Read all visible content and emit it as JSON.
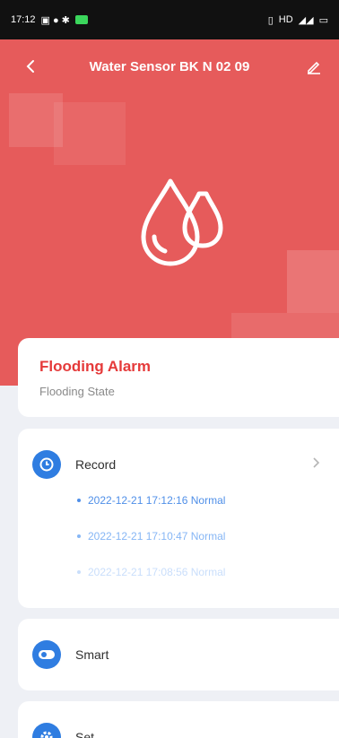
{
  "status_bar": {
    "time": "17:12",
    "right_text": "HD"
  },
  "header": {
    "title": "Water Sensor BK N 02 09",
    "back_icon": "back-chevron-icon",
    "edit_icon": "edit-pencil-icon"
  },
  "hero": {
    "icon": "water-drops-icon",
    "bg_color": "#e65b5b"
  },
  "alarm": {
    "title": "Flooding Alarm",
    "subtitle": "Flooding State",
    "title_color": "#e53a3a"
  },
  "record": {
    "label": "Record",
    "icon": "clock-icon",
    "items": [
      {
        "text": "2022-12-21 17:12:16 Normal",
        "color": "#4f8fe8"
      },
      {
        "text": "2022-12-21 17:10:47 Normal",
        "color": "#86b6f5"
      },
      {
        "text": "2022-12-21 17:08:56 Normal",
        "color": "#c9defb"
      }
    ]
  },
  "smart": {
    "label": "Smart",
    "icon": "toggle-icon"
  },
  "set": {
    "label": "Set",
    "icon": "gear-icon"
  },
  "colors": {
    "accent_blue": "#2f7de1",
    "background": "#eef0f5"
  }
}
